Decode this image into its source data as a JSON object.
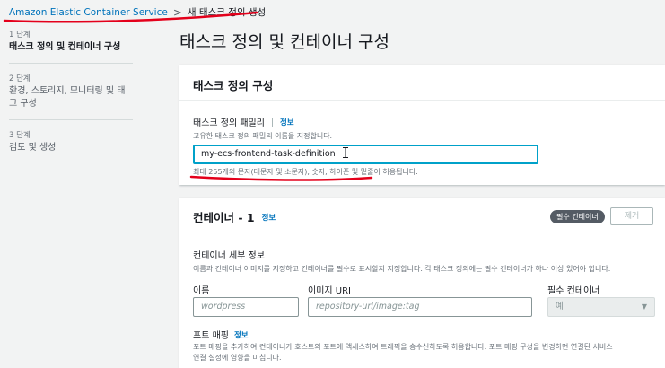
{
  "breadcrumb": {
    "root": "Amazon Elastic Container Service",
    "separator": ">",
    "current": "새 태스크 정의 생성"
  },
  "steps": [
    {
      "num": "1 단계",
      "title": "태스크 정의 및 컨테이너 구성"
    },
    {
      "num": "2 단계",
      "title": "환경, 스토리지, 모니터링 및 태그 구성"
    },
    {
      "num": "3 단계",
      "title": "검토 및 생성"
    }
  ],
  "page_title": "태스크 정의 및 컨테이너 구성",
  "task_definition_panel": {
    "title": "태스크 정의 구성",
    "family_label": "태스크 정의 패밀리",
    "info": "정보",
    "family_desc": "고유한 태스크 정의 패밀리 이름을 지정합니다.",
    "family_value": "my-ecs-frontend-task-definition",
    "family_hint": "최대 255개의 문자(대문자 및 소문자), 숫자, 하이픈 및 밑줄이 허용됩니다."
  },
  "container_panel": {
    "title": "컨테이너 - 1",
    "info": "정보",
    "essential_badge": "필수 컨테이너",
    "remove_label": "제거",
    "details_title": "컨테이너 세부 정보",
    "details_desc": "이름과 컨테이너 이미지를 지정하고 컨테이너를 필수로 표시할지 지정합니다. 각 태스크 정의에는 필수 컨테이너가 하나 이상 있어야 합니다.",
    "name_label": "이름",
    "name_placeholder": "wordpress",
    "image_label": "이미지 URI",
    "image_placeholder": "repository-url/image:tag",
    "essential_label": "필수 컨테이너",
    "essential_value": "예",
    "port_mapping_label": "포트 매핑",
    "port_mapping_info": "정보",
    "port_mapping_desc": "포트 매핑을 추가하여 컨테이너가 호스트의 포트에 액세스하여 트래픽을 송수신하도록 허용합니다. 포트 매핑 구성을 변경하면 연결된 서비스",
    "port_mapping_desc2": "연결 설정에 영향을 미칩니다."
  },
  "colors": {
    "link": "#0073bb",
    "focus_border": "#00a1c9",
    "annotation": "#e4001b",
    "page_bg": "#f2f3f3"
  }
}
